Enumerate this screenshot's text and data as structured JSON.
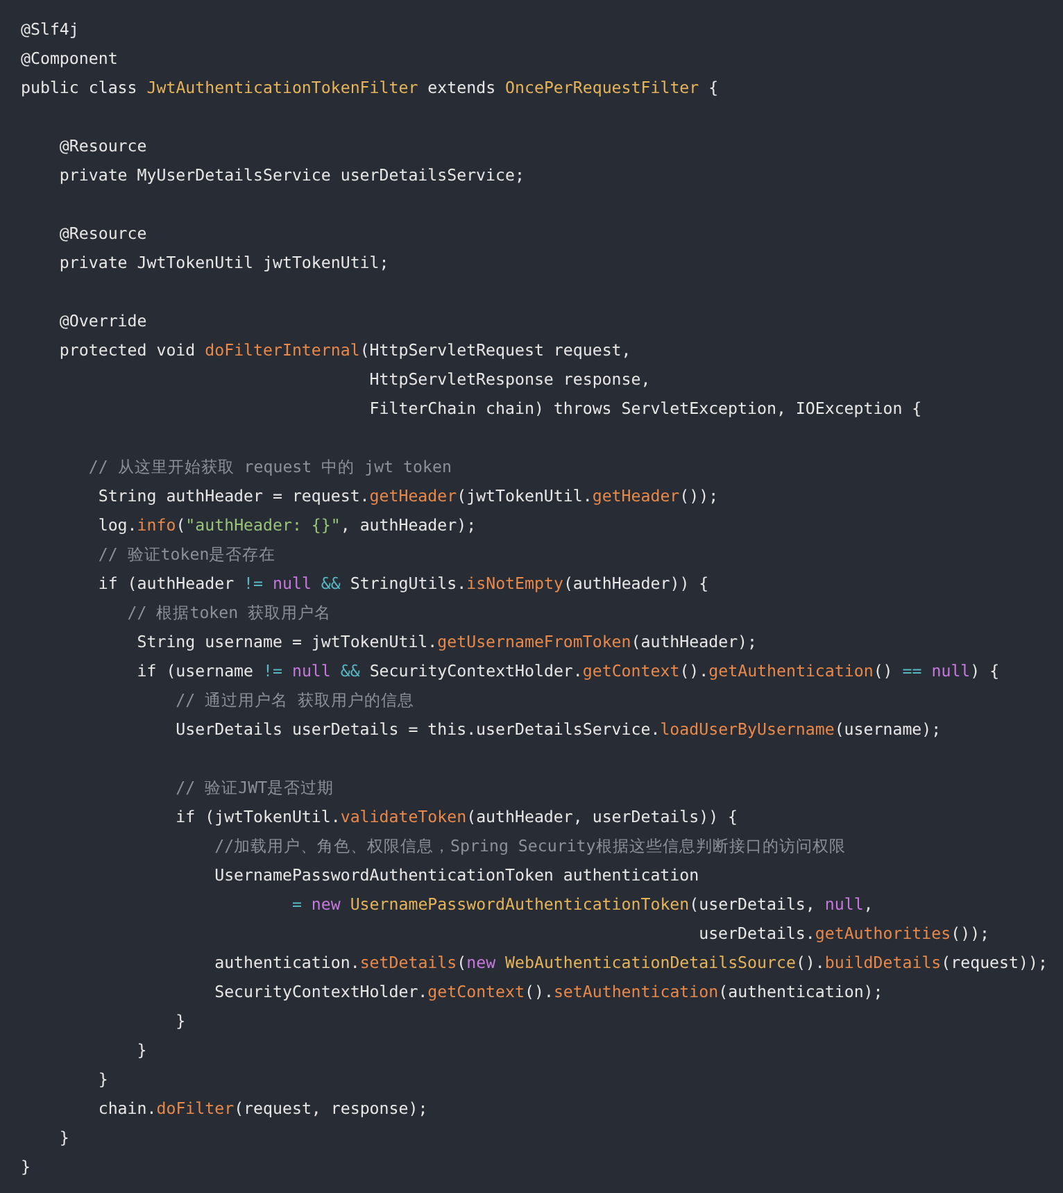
{
  "code_lines": [
    {
      "kind": "code",
      "tokens": [
        {
          "kind": "plain",
          "text": "@Slf4j"
        }
      ]
    },
    {
      "kind": "code",
      "tokens": [
        {
          "kind": "plain",
          "text": "@Component"
        }
      ]
    },
    {
      "kind": "code",
      "tokens": [
        {
          "kind": "plain",
          "text": "public class "
        },
        {
          "kind": "type",
          "text": "JwtAuthenticationTokenFilter"
        },
        {
          "kind": "plain",
          "text": " extends "
        },
        {
          "kind": "type",
          "text": "OncePerRequestFilter"
        },
        {
          "kind": "plain",
          "text": " {"
        }
      ]
    },
    {
      "kind": "blank"
    },
    {
      "kind": "code",
      "tokens": [
        {
          "kind": "plain",
          "text": "    @Resource"
        }
      ]
    },
    {
      "kind": "code",
      "tokens": [
        {
          "kind": "plain",
          "text": "    private MyUserDetailsService userDetailsService;"
        }
      ]
    },
    {
      "kind": "blank"
    },
    {
      "kind": "code",
      "tokens": [
        {
          "kind": "plain",
          "text": "    @Resource"
        }
      ]
    },
    {
      "kind": "code",
      "tokens": [
        {
          "kind": "plain",
          "text": "    private JwtTokenUtil jwtTokenUtil;"
        }
      ]
    },
    {
      "kind": "blank"
    },
    {
      "kind": "code",
      "tokens": [
        {
          "kind": "plain",
          "text": "    @Override"
        }
      ]
    },
    {
      "kind": "code",
      "tokens": [
        {
          "kind": "plain",
          "text": "    protected void "
        },
        {
          "kind": "method",
          "text": "doFilterInternal"
        },
        {
          "kind": "plain",
          "text": "(HttpServletRequest request,"
        }
      ]
    },
    {
      "kind": "code",
      "tokens": [
        {
          "kind": "plain",
          "text": "                                    HttpServletResponse response,"
        }
      ]
    },
    {
      "kind": "code",
      "tokens": [
        {
          "kind": "plain",
          "text": "                                    FilterChain chain) throws ServletException, IOException {"
        }
      ]
    },
    {
      "kind": "blank"
    },
    {
      "kind": "code",
      "tokens": [
        {
          "kind": "comment",
          "text": "       // 从这里开始获取 request 中的 jwt token"
        }
      ]
    },
    {
      "kind": "code",
      "tokens": [
        {
          "kind": "plain",
          "text": "        String authHeader = request."
        },
        {
          "kind": "method",
          "text": "getHeader"
        },
        {
          "kind": "plain",
          "text": "(jwtTokenUtil."
        },
        {
          "kind": "method",
          "text": "getHeader"
        },
        {
          "kind": "plain",
          "text": "());"
        }
      ]
    },
    {
      "kind": "code",
      "tokens": [
        {
          "kind": "plain",
          "text": "        log."
        },
        {
          "kind": "method",
          "text": "info"
        },
        {
          "kind": "plain",
          "text": "("
        },
        {
          "kind": "string",
          "text": "\"authHeader: {}\""
        },
        {
          "kind": "plain",
          "text": ", authHeader);"
        }
      ]
    },
    {
      "kind": "code",
      "tokens": [
        {
          "kind": "comment",
          "text": "        // 验证token是否存在"
        }
      ]
    },
    {
      "kind": "code",
      "tokens": [
        {
          "kind": "plain",
          "text": "        if (authHeader "
        },
        {
          "kind": "operator",
          "text": "!= "
        },
        {
          "kind": "literal",
          "text": "null "
        },
        {
          "kind": "operator",
          "text": "&&"
        },
        {
          "kind": "plain",
          "text": " StringUtils."
        },
        {
          "kind": "method",
          "text": "isNotEmpty"
        },
        {
          "kind": "plain",
          "text": "(authHeader)) {"
        }
      ]
    },
    {
      "kind": "code",
      "tokens": [
        {
          "kind": "comment",
          "text": "           // 根据token 获取用户名"
        }
      ]
    },
    {
      "kind": "code",
      "tokens": [
        {
          "kind": "plain",
          "text": "            String username = jwtTokenUtil."
        },
        {
          "kind": "method",
          "text": "getUsernameFromToken"
        },
        {
          "kind": "plain",
          "text": "(authHeader);"
        }
      ]
    },
    {
      "kind": "code",
      "tokens": [
        {
          "kind": "plain",
          "text": "            if (username "
        },
        {
          "kind": "operator",
          "text": "!= "
        },
        {
          "kind": "literal",
          "text": "null "
        },
        {
          "kind": "operator",
          "text": "&&"
        },
        {
          "kind": "plain",
          "text": " SecurityContextHolder."
        },
        {
          "kind": "method",
          "text": "getContext"
        },
        {
          "kind": "plain",
          "text": "()."
        },
        {
          "kind": "method",
          "text": "getAuthentication"
        },
        {
          "kind": "plain",
          "text": "() "
        },
        {
          "kind": "operator",
          "text": "== "
        },
        {
          "kind": "literal",
          "text": "null"
        },
        {
          "kind": "plain",
          "text": ") {"
        }
      ]
    },
    {
      "kind": "code",
      "tokens": [
        {
          "kind": "comment",
          "text": "                // 通过用户名 获取用户的信息"
        }
      ]
    },
    {
      "kind": "code",
      "tokens": [
        {
          "kind": "plain",
          "text": "                UserDetails userDetails = this.userDetailsService."
        },
        {
          "kind": "method",
          "text": "loadUserByUsername"
        },
        {
          "kind": "plain",
          "text": "(username);"
        }
      ]
    },
    {
      "kind": "blank"
    },
    {
      "kind": "code",
      "tokens": [
        {
          "kind": "comment",
          "text": "                // 验证JWT是否过期"
        }
      ]
    },
    {
      "kind": "code",
      "tokens": [
        {
          "kind": "plain",
          "text": "                if (jwtTokenUtil."
        },
        {
          "kind": "method",
          "text": "validateToken"
        },
        {
          "kind": "plain",
          "text": "(authHeader, userDetails)) {"
        }
      ]
    },
    {
      "kind": "code",
      "tokens": [
        {
          "kind": "comment",
          "text": "                    //加载用户、角色、权限信息，Spring Security根据这些信息判断接口的访问权限"
        }
      ]
    },
    {
      "kind": "code",
      "tokens": [
        {
          "kind": "plain",
          "text": "                    UsernamePasswordAuthenticationToken authentication"
        }
      ]
    },
    {
      "kind": "code",
      "tokens": [
        {
          "kind": "operator",
          "text": "                            = "
        },
        {
          "kind": "literal",
          "text": "new "
        },
        {
          "kind": "type",
          "text": "UsernamePasswordAuthenticationToken"
        },
        {
          "kind": "plain",
          "text": "(userDetails, "
        },
        {
          "kind": "literal",
          "text": "null"
        },
        {
          "kind": "plain",
          "text": ","
        }
      ]
    },
    {
      "kind": "code",
      "tokens": [
        {
          "kind": "plain",
          "text": "                                                                      userDetails."
        },
        {
          "kind": "method",
          "text": "getAuthorities"
        },
        {
          "kind": "plain",
          "text": "());"
        }
      ]
    },
    {
      "kind": "code",
      "tokens": [
        {
          "kind": "plain",
          "text": "                    authentication."
        },
        {
          "kind": "method",
          "text": "setDetails"
        },
        {
          "kind": "plain",
          "text": "("
        },
        {
          "kind": "literal",
          "text": "new "
        },
        {
          "kind": "type",
          "text": "WebAuthenticationDetailsSource"
        },
        {
          "kind": "plain",
          "text": "()."
        },
        {
          "kind": "method",
          "text": "buildDetails"
        },
        {
          "kind": "plain",
          "text": "(request));"
        }
      ]
    },
    {
      "kind": "code",
      "tokens": [
        {
          "kind": "plain",
          "text": "                    SecurityContextHolder."
        },
        {
          "kind": "method",
          "text": "getContext"
        },
        {
          "kind": "plain",
          "text": "()."
        },
        {
          "kind": "method",
          "text": "setAuthentication"
        },
        {
          "kind": "plain",
          "text": "(authentication);"
        }
      ]
    },
    {
      "kind": "code",
      "tokens": [
        {
          "kind": "plain",
          "text": "                }"
        }
      ]
    },
    {
      "kind": "code",
      "tokens": [
        {
          "kind": "plain",
          "text": "            }"
        }
      ]
    },
    {
      "kind": "code",
      "tokens": [
        {
          "kind": "plain",
          "text": "        }"
        }
      ]
    },
    {
      "kind": "code",
      "tokens": [
        {
          "kind": "plain",
          "text": "        chain."
        },
        {
          "kind": "method",
          "text": "doFilter"
        },
        {
          "kind": "plain",
          "text": "(request, response);"
        }
      ]
    },
    {
      "kind": "code",
      "tokens": [
        {
          "kind": "plain",
          "text": "    }"
        }
      ]
    },
    {
      "kind": "code",
      "tokens": [
        {
          "kind": "plain",
          "text": "}"
        }
      ]
    }
  ]
}
